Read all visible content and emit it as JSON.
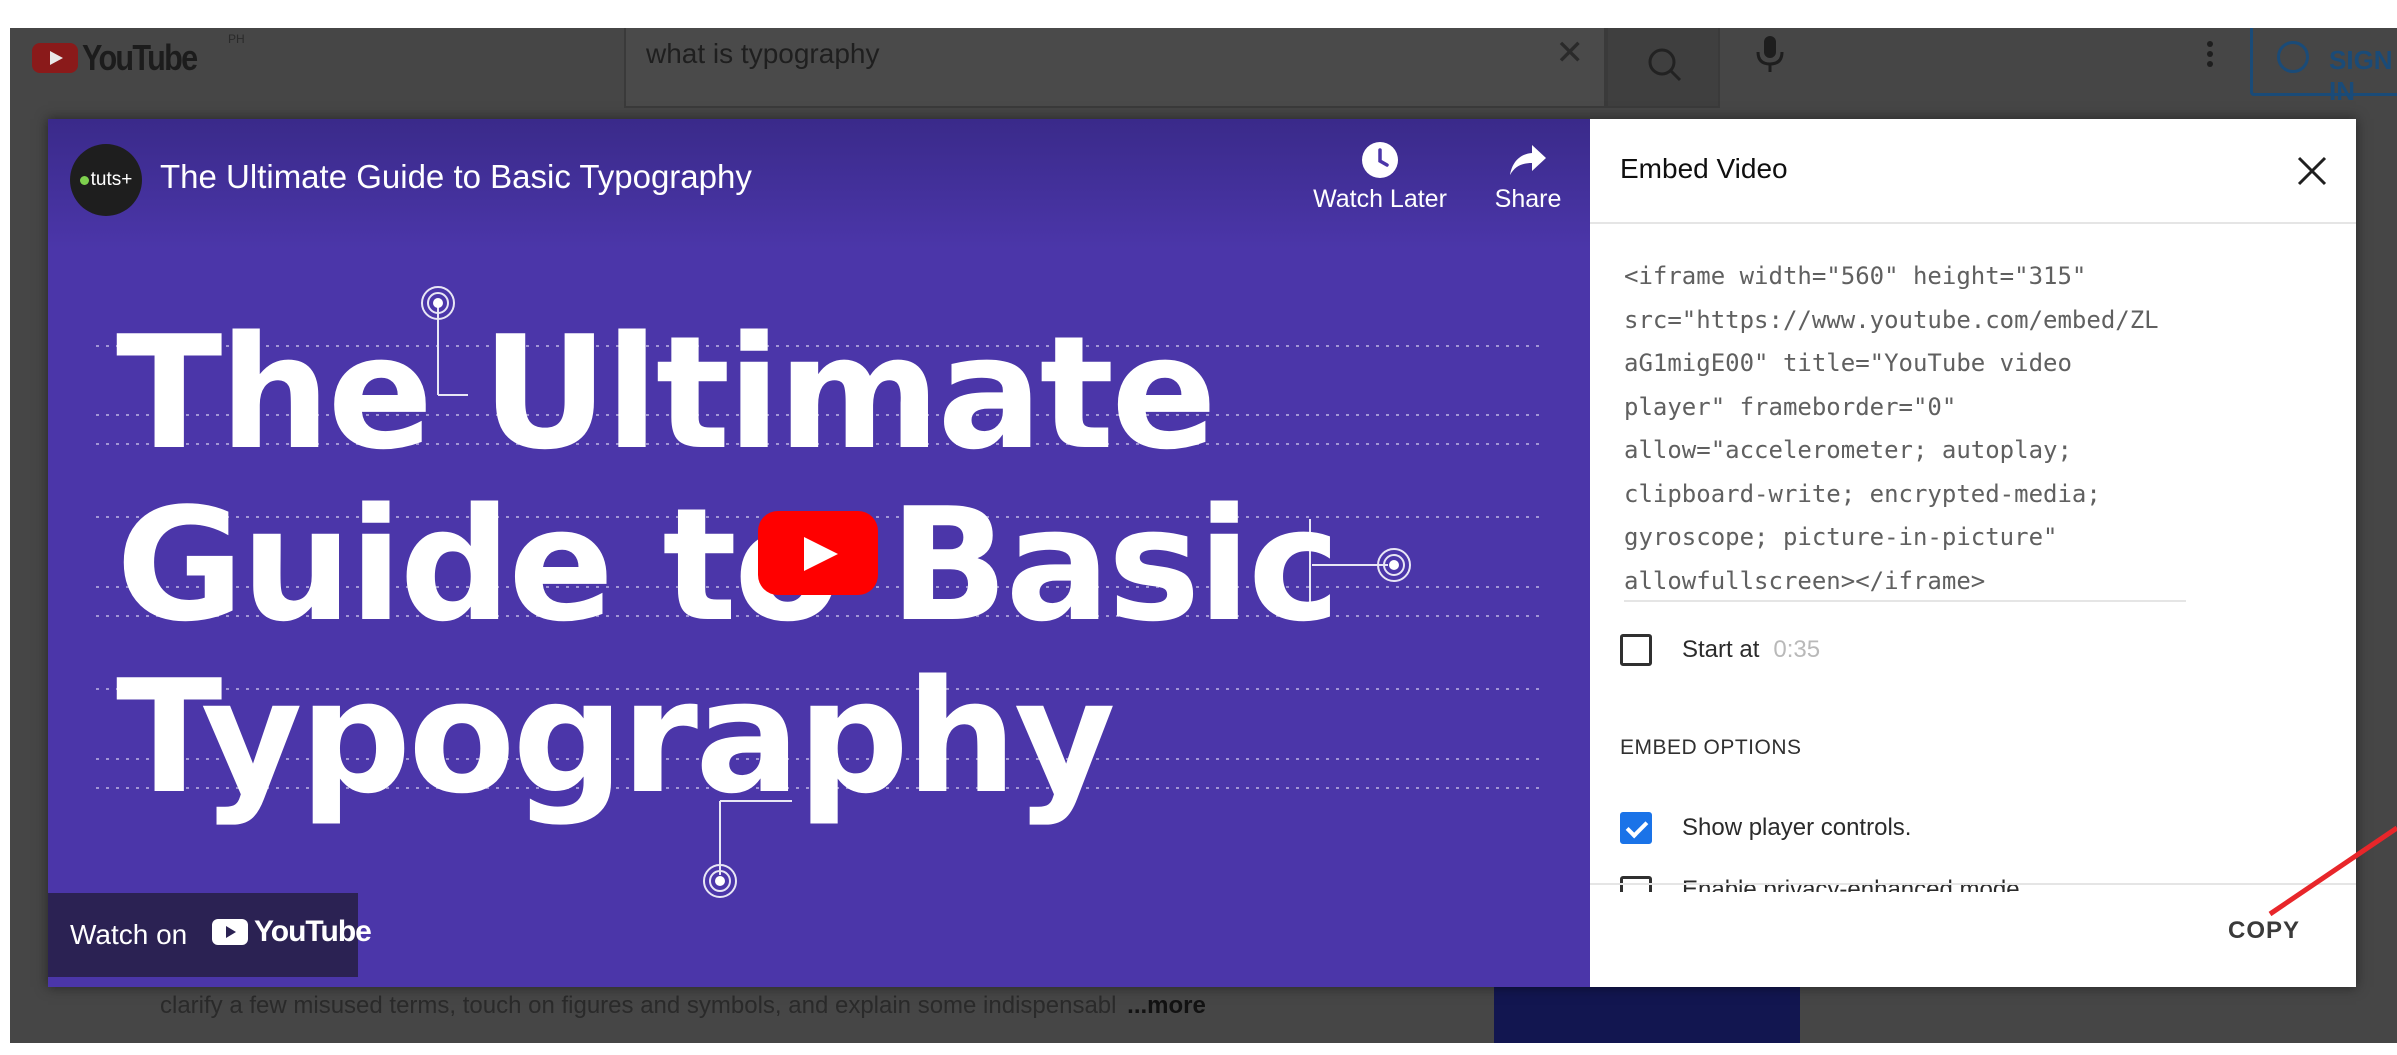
{
  "background_page": {
    "logo_text": "YouTube",
    "logo_superscript": "PH",
    "search_query": "what is typography",
    "sign_in_label": "SIGN IN",
    "description_text": "clarify a few misused terms, touch on figures and symbols, and explain some indispensabl",
    "more_label": "...more"
  },
  "video": {
    "channel_badge": "tuts+",
    "title": "The Ultimate Guide to Basic Typography",
    "watch_later_label": "Watch Later",
    "share_label": "Share",
    "thumbnail_lines": [
      "The Ultimate",
      "Guide to Basic",
      "Typography"
    ],
    "watch_on_label": "Watch on",
    "watch_on_brand": "YouTube"
  },
  "embed": {
    "title": "Embed Video",
    "code_lines": [
      "<iframe width=\"560\" height=\"315\"",
      "src=\"https://www.youtube.com/embed/ZL",
      "aG1migE00\" title=\"YouTube video",
      "player\" frameborder=\"0\"",
      "allow=\"accelerometer; autoplay;",
      "clipboard-write; encrypted-media;",
      "gyroscope; picture-in-picture\"",
      "allowfullscreen></iframe>"
    ],
    "start_at_label": "Start at",
    "start_at_time": "0:35",
    "start_at_checked": false,
    "options_header": "EMBED OPTIONS",
    "show_controls_label": "Show player controls.",
    "show_controls_checked": true,
    "privacy_label": "Enable privacy-enhanced mode.",
    "copy_label": "COPY"
  },
  "colors": {
    "thumbnail_background": "#4b36a9",
    "play_button": "#ff0000",
    "checkbox_checked": "#1a73e8",
    "annotation_arrow": "#e8262a"
  }
}
